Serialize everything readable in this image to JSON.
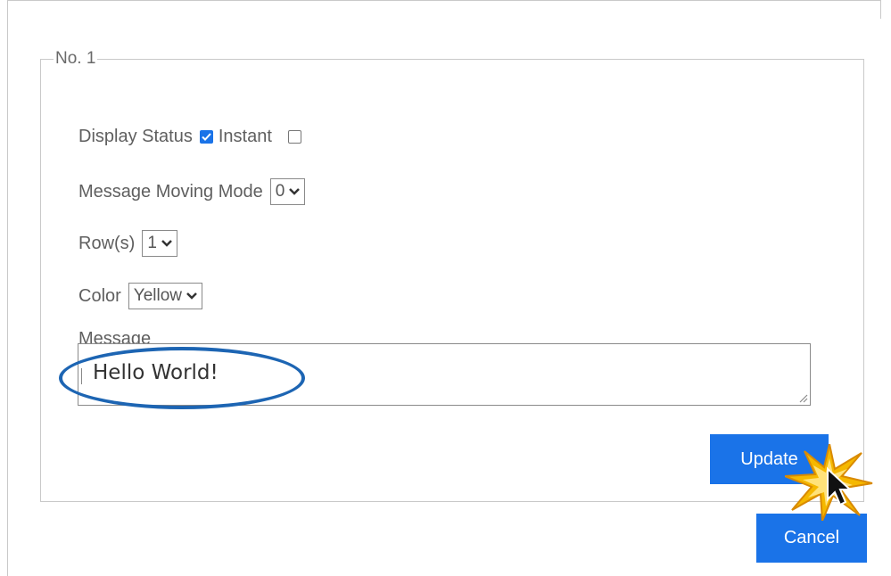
{
  "form": {
    "group_legend": "No. 1",
    "display_status": {
      "label": "Display Status",
      "checked": true
    },
    "instant": {
      "label": "Instant",
      "checked": false
    },
    "moving_mode": {
      "label": "Message Moving Mode",
      "value": "0"
    },
    "rows": {
      "label": "Row(s)",
      "value": "1"
    },
    "color": {
      "label": "Color",
      "value": "Yellow"
    },
    "message": {
      "label": "Message",
      "value": "Hello World!"
    }
  },
  "buttons": {
    "update_label": "Update",
    "cancel_label": "Cancel"
  },
  "annotation": {
    "highlight_color": "#1d65b3",
    "click_burst_color": "#f5b800"
  },
  "colors": {
    "accent": "#1a73e8",
    "border": "#c9c9c9"
  }
}
